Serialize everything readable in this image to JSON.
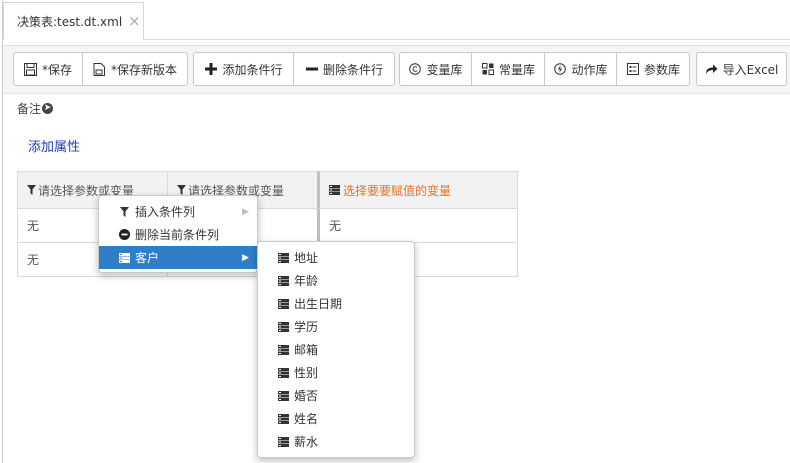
{
  "tab": {
    "title": "决策表:test.dt.xml",
    "close": "×"
  },
  "toolbar": {
    "save": "*保存",
    "save_new_version": "*保存新版本",
    "add_condition_row": "添加条件行",
    "delete_condition_row": "删除条件行",
    "variable_lib": "变量库",
    "constant_lib": "常量库",
    "action_lib": "动作库",
    "parameter_lib": "参数库",
    "import_excel": "导入Excel"
  },
  "remark": {
    "label": "备注"
  },
  "add_attribute": "添加属性",
  "table": {
    "headers": [
      "请选择参数或变量",
      "请选择参数或变量",
      "选择要要赋值的变量"
    ],
    "rows": [
      [
        "无",
        "",
        "无"
      ],
      [
        "无",
        "",
        ""
      ]
    ]
  },
  "context_menu": {
    "items": [
      {
        "label": "插入条件列",
        "icon": "filter-icon",
        "has_submenu": true
      },
      {
        "label": "删除当前条件列",
        "icon": "minus-circle-icon",
        "has_submenu": false
      },
      {
        "label": "客户",
        "icon": "database-icon",
        "has_submenu": true,
        "active": true
      }
    ]
  },
  "submenu": {
    "items": [
      "地址",
      "年龄",
      "出生日期",
      "学历",
      "邮箱",
      "性别",
      "婚否",
      "姓名",
      "薪水"
    ]
  },
  "colors": {
    "accent": "#2f7fc8",
    "action_header": "#e8702a",
    "link": "#1a3fbf"
  }
}
